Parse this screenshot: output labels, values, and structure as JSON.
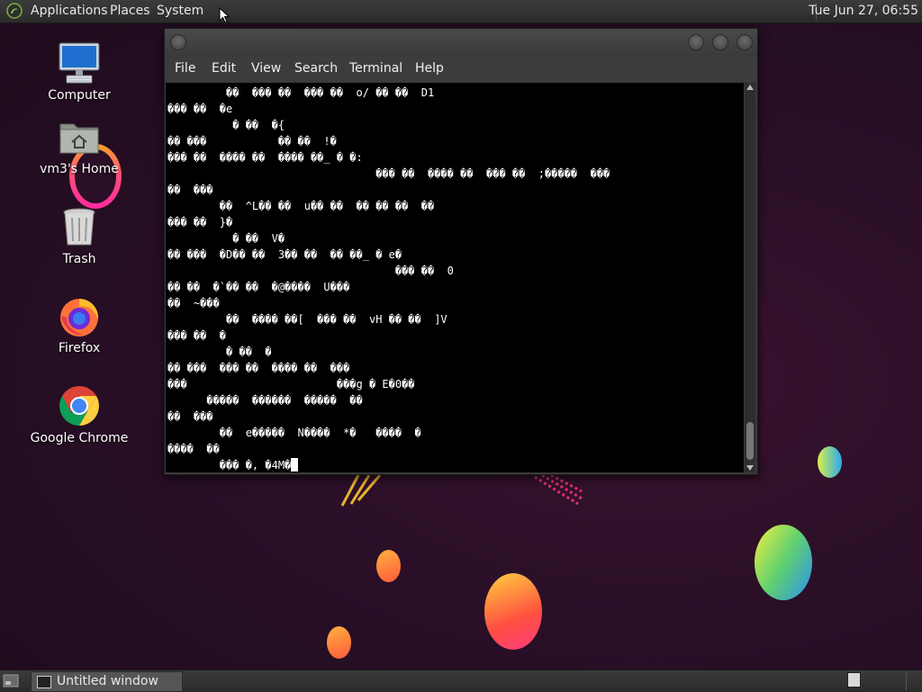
{
  "top_panel": {
    "menus": [
      "Applications",
      "Places",
      "System"
    ],
    "clock": "Tue Jun 27, 06:55"
  },
  "desktop": {
    "icons": [
      {
        "label": "Computer",
        "icon": "computer-icon"
      },
      {
        "label": "vm3's Home",
        "icon": "home-folder-icon"
      },
      {
        "label": "Trash",
        "icon": "trash-icon"
      },
      {
        "label": "Firefox",
        "icon": "firefox-icon"
      },
      {
        "label": "Google Chrome",
        "icon": "chrome-icon"
      }
    ]
  },
  "terminal": {
    "menus": [
      "File",
      "Edit",
      "View",
      "Search",
      "Terminal",
      "Help"
    ],
    "output": "         ��  ��� ��  ��� ��  o/ �� ��  D1\n��� ��  �e\n          � ��  �{\n�� ���           �� ��  !�\n��� ��  ���� ��  ���� ��_ � �:\n                                ��� ��  ���� ��  ��� ��  ;�����  ���\n��  ���\n        ��  ^L�� ��  u�� ��  �� �� ��  ��\n��� ��  }�\n          � ��  V�\n�� ���  �D�� ��  3�� ��  �� ��_ � e�\n                                   ��� ��  0\n�� ��  �`�� ��  �@����  U���\n��  ~���\n         ��  ���� ��[  ��� ��  vH �� ��  ]V\n��� ��  �\n         � ��  �\n�� ���  ��� ��  ���� ��  ���\n���                       ���g � E�0��\n      �����  ������  �����  ��\n��  ���\n        ��  e�����  N����  *�   ����  �\n����  ��\n        ��� �, �4M�"
  },
  "taskbar": {
    "tasks": [
      {
        "label": "Untitled window"
      }
    ]
  },
  "colors": {
    "wallpaper": "#2a0f27",
    "panel": "#2f2f2f",
    "terminal_bg": "#000000",
    "terminal_fg": "#ffffff"
  }
}
